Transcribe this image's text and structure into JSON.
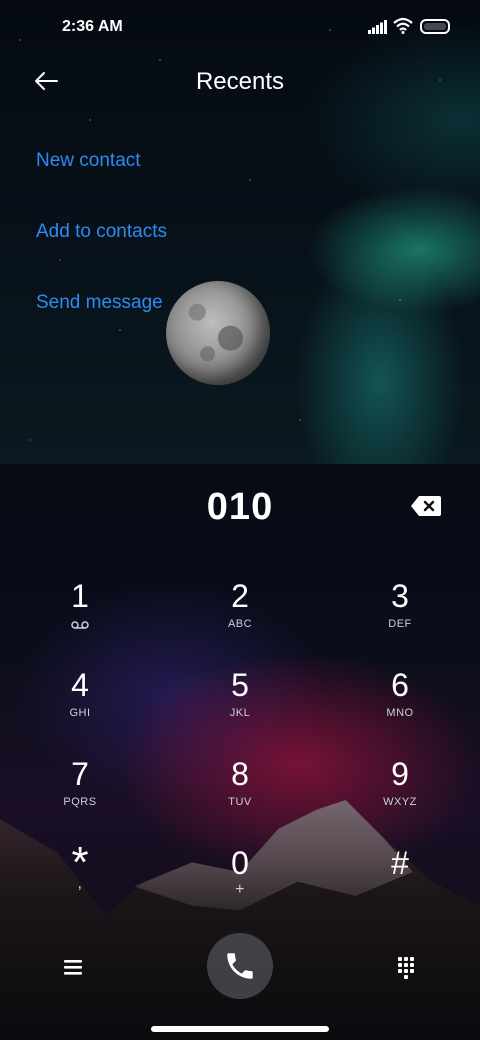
{
  "status_bar": {
    "time": "2:36 AM"
  },
  "header": {
    "title": "Recents",
    "back_icon": "back-arrow-icon"
  },
  "actions": {
    "new_contact": "New contact",
    "add_to_contacts": "Add to contacts",
    "send_message": "Send message"
  },
  "dialer": {
    "number": "010",
    "keys": [
      {
        "digit": "1",
        "letters": ""
      },
      {
        "digit": "2",
        "letters": "ABC"
      },
      {
        "digit": "3",
        "letters": "DEF"
      },
      {
        "digit": "4",
        "letters": "GHI"
      },
      {
        "digit": "5",
        "letters": "JKL"
      },
      {
        "digit": "6",
        "letters": "MNO"
      },
      {
        "digit": "7",
        "letters": "PQRS"
      },
      {
        "digit": "8",
        "letters": "TUV"
      },
      {
        "digit": "9",
        "letters": "WXYZ"
      },
      {
        "digit": "*",
        "letters": ","
      },
      {
        "digit": "0",
        "letters": "+"
      },
      {
        "digit": "#",
        "letters": ""
      }
    ]
  },
  "colors": {
    "link": "#2d8cf0"
  }
}
